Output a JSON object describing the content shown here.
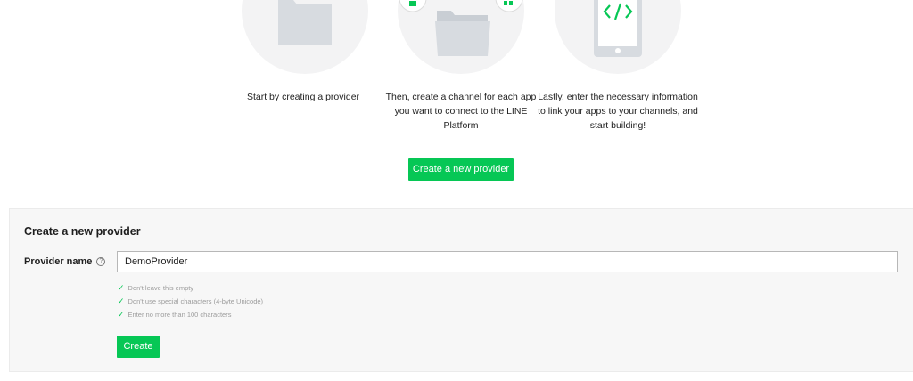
{
  "steps": [
    {
      "text": "Start by creating a provider",
      "icon": "folder-icon"
    },
    {
      "text": "Then, create a channel for each app you want to connect to the LINE Platform",
      "icon": "open-folder-icon"
    },
    {
      "text": "Lastly, enter the necessary information to link your apps to your channels, and start building!",
      "icon": "phone-code-icon"
    }
  ],
  "hero_button": "Create a new provider",
  "form": {
    "title": "Create a new provider",
    "provider_name_label": "Provider name",
    "help_glyph": "?",
    "provider_name_value": "DemoProvider",
    "rules": [
      "Don't leave this empty",
      "Don't use special characters (4-byte Unicode)",
      "Enter no more than 100 characters"
    ],
    "create_button": "Create"
  },
  "colors": {
    "accent": "#06c755",
    "panel_bg": "#f7f7f7",
    "circle_bg": "#f3f3f4",
    "icon_gray": "#d7dbe0"
  }
}
